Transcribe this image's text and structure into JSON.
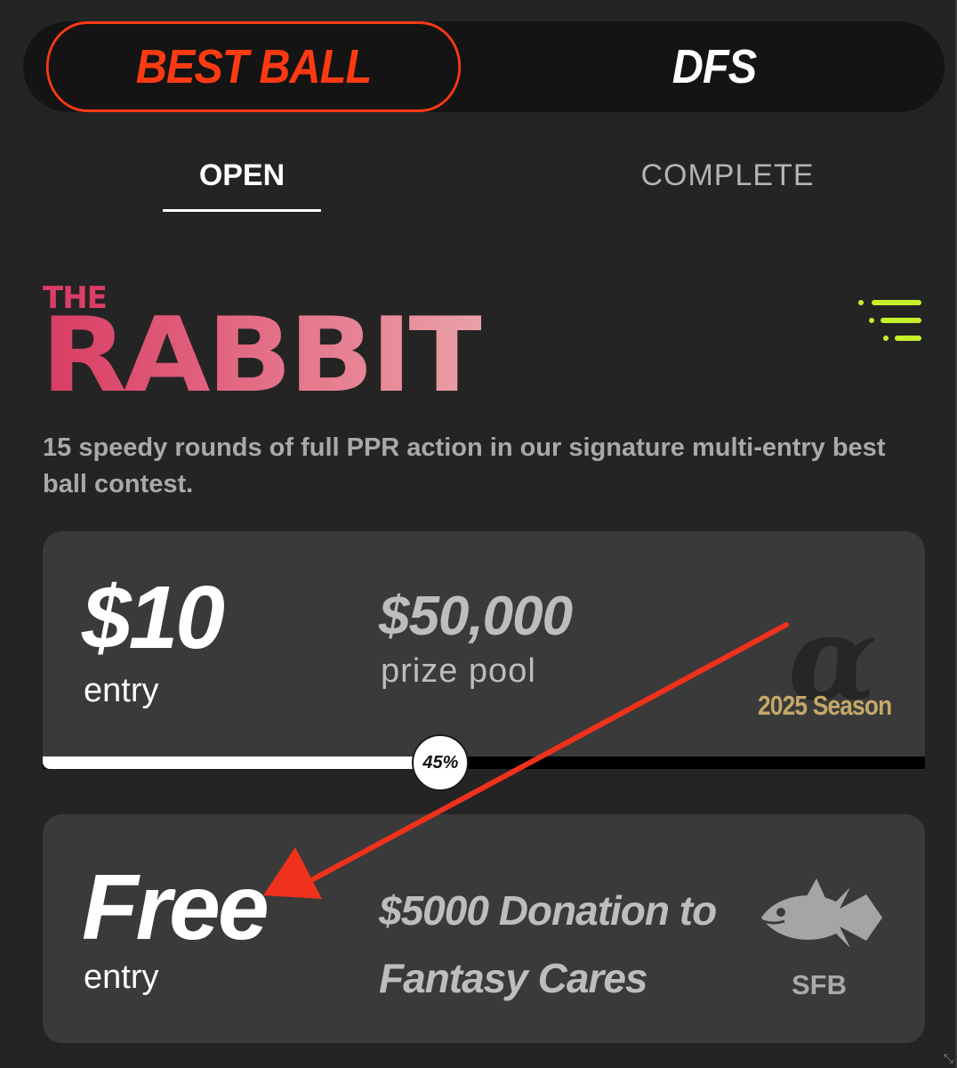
{
  "toggle": {
    "active_label": "BEST BALL",
    "inactive_label": "DFS"
  },
  "tabs": {
    "open": "OPEN",
    "complete": "COMPLETE"
  },
  "contest": {
    "logo_small": "THE",
    "logo_big": "RABBIT",
    "description": "15 speedy rounds of full PPR action in our signature multi-entry best ball contest."
  },
  "cards": [
    {
      "entry_price": "$10",
      "entry_label": "entry",
      "prize_amount": "$50,000",
      "prize_label": "prize pool",
      "season_label": "2025 Season",
      "badge_icon": "alpha-icon",
      "progress_text": "45%",
      "progress_fraction": 0.45
    },
    {
      "entry_price": "Free",
      "entry_label": "entry",
      "donation_line1": "$5000 Donation to",
      "donation_line2": "Fantasy Cares",
      "badge_icon": "fish-icon",
      "badge_label": "SFB"
    }
  ],
  "colors": {
    "accent": "#ff3a12",
    "background": "#242424",
    "card": "#3a3a3a",
    "season_gold": "#c4a868",
    "filter_green": "#c6f02a",
    "annotation_arrow": "#f0311c"
  }
}
